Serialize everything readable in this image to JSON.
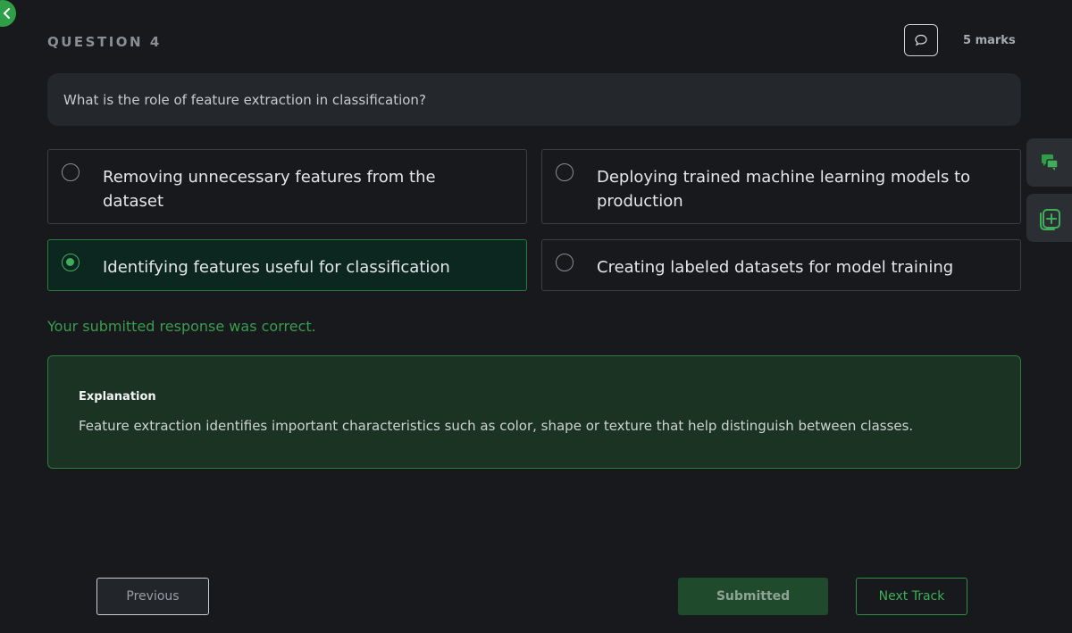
{
  "header": {
    "question_label": "QUESTION 4",
    "marks": "5 marks",
    "comment_icon": "chat-bubble-icon"
  },
  "question": {
    "text": "What is the role of feature extraction in classification?"
  },
  "options": [
    {
      "text": "Removing unnecessary features from the dataset",
      "selected": false
    },
    {
      "text": "Deploying trained machine learning models to production",
      "selected": false
    },
    {
      "text": "Identifying features useful for classification",
      "selected": true
    },
    {
      "text": "Creating labeled datasets for model training",
      "selected": false
    }
  ],
  "feedback": {
    "text": "Your submitted response was correct."
  },
  "explanation": {
    "title": "Explanation",
    "body": "Feature extraction identifies important characteristics such as color, shape or texture that help distinguish between classes."
  },
  "footer": {
    "previous_label": "Previous",
    "submitted_label": "Submitted",
    "next_label": "Next Track"
  },
  "side_tabs": {
    "chat_icon": "discussion-icon",
    "add_icon": "add-card-icon"
  },
  "colors": {
    "accent_green": "#3fae5a",
    "background": "#17191c",
    "explanation_bg": "#1b3323"
  }
}
